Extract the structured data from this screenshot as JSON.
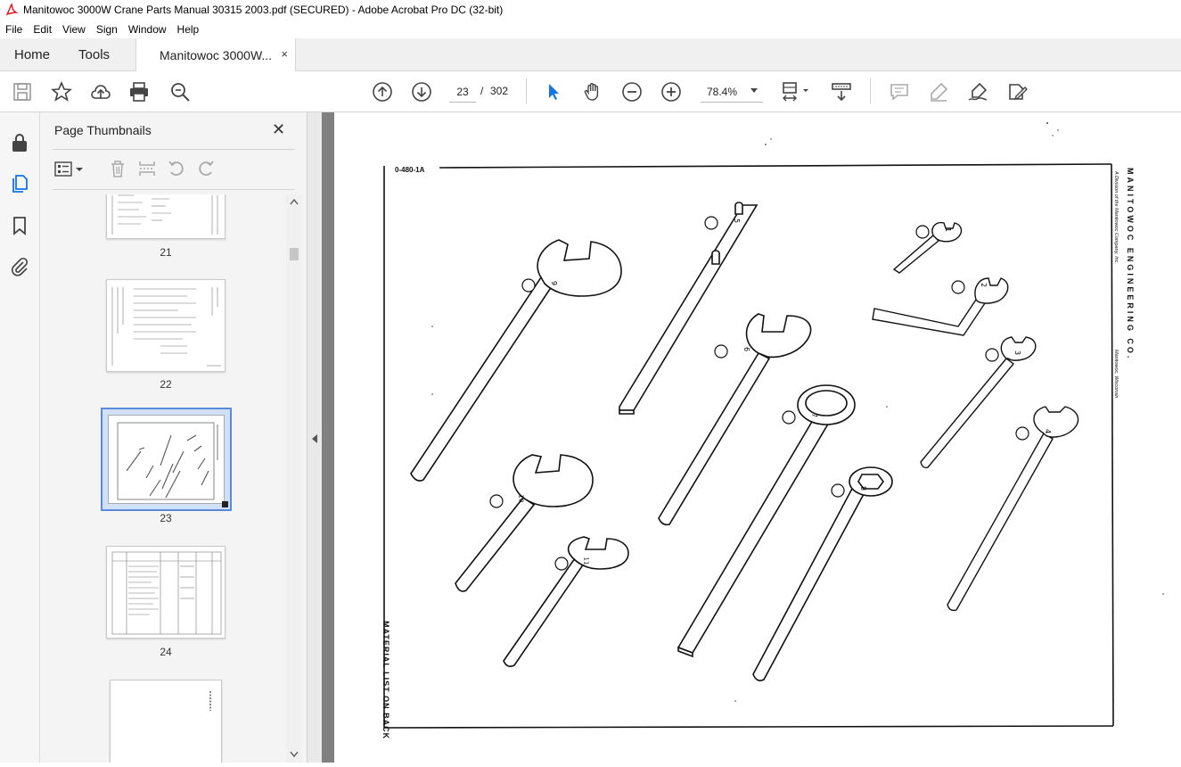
{
  "window": {
    "title": "Manitowoc 3000W Crane Parts Manual 30315 2003.pdf (SECURED) - Adobe Acrobat Pro DC (32-bit)"
  },
  "menu": [
    "File",
    "Edit",
    "View",
    "Sign",
    "Window",
    "Help"
  ],
  "tabs": {
    "home": "Home",
    "tools": "Tools",
    "document": "Manitowoc 3000W...",
    "close_glyph": "×"
  },
  "toolbar": {
    "current_page": "23",
    "page_separator": "/",
    "total_pages": "302",
    "zoom": "78.4%"
  },
  "panel": {
    "title": "Page Thumbnails",
    "close_glyph": "✕",
    "thumbnails": [
      {
        "label": "21"
      },
      {
        "label": "22"
      },
      {
        "label": "23",
        "selected": true
      },
      {
        "label": "24"
      }
    ]
  },
  "document": {
    "drawing_number": "0-480-1A",
    "company": "MANITOWOC ENGINEERING CO.",
    "division": "A Division of the Manitowoc Company, Inc.",
    "location": "Manitowoc, Wisconsin",
    "footer_note": "MATERIAL LIST ON BACK",
    "callouts": [
      "1",
      "2",
      "3",
      "4",
      "5",
      "6",
      "7",
      "8",
      "9",
      "10",
      "11"
    ]
  },
  "colors": {
    "accent": "#1473e6",
    "selection_border": "#5b8ad8",
    "doc_background": "#808080"
  }
}
